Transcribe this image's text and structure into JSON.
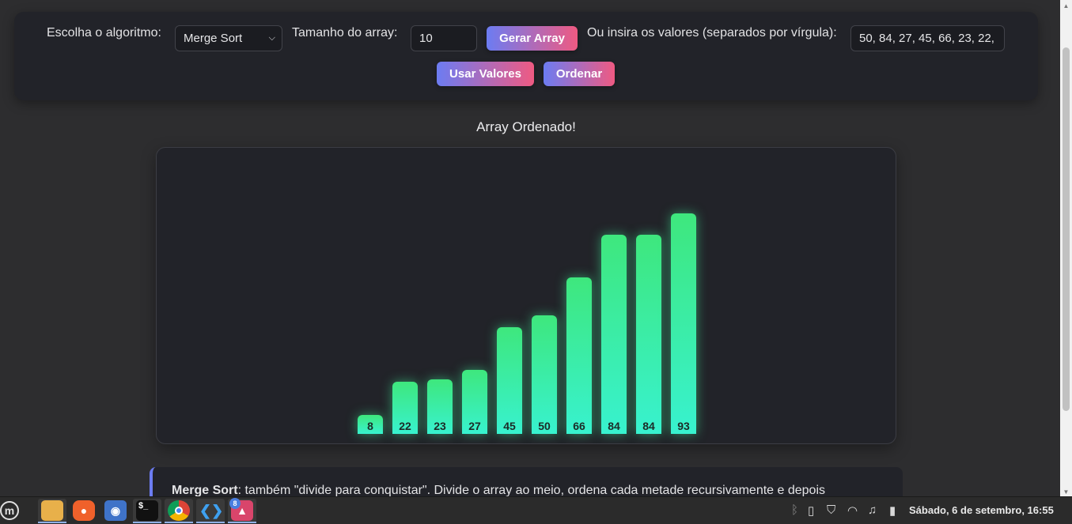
{
  "controls": {
    "algorithm_label": "Escolha o algoritmo:",
    "algorithm_selected": "Merge Sort",
    "size_label": "Tamanho do array:",
    "size_value": "10",
    "generate_button": "Gerar Array",
    "values_label": "Ou insira os valores (separados por vírgula):",
    "values_input": "50, 84, 27, 45, 66, 23, 22,",
    "use_values_button": "Usar Valores",
    "sort_button": "Ordenar"
  },
  "status_text": "Array Ordenado!",
  "chart_data": {
    "type": "bar",
    "values": [
      8,
      22,
      23,
      27,
      45,
      50,
      66,
      84,
      84,
      93
    ],
    "labels": [
      "8",
      "22",
      "23",
      "27",
      "45",
      "50",
      "66",
      "84",
      "84",
      "93"
    ],
    "bar_color_top": "#3ee77d",
    "bar_color_bottom": "#38f2cf"
  },
  "info": {
    "title": "Merge Sort",
    "text": ": também \"divide para conquistar\". Divide o array ao meio, ordena cada metade recursivamente e depois"
  },
  "taskbar": {
    "apps": [
      {
        "name": "menu-icon",
        "glyph": "m"
      },
      {
        "name": "files-icon",
        "glyph": ""
      },
      {
        "name": "firefox-icon",
        "glyph": "●"
      },
      {
        "name": "camera-icon",
        "glyph": "◉"
      },
      {
        "name": "terminal-icon",
        "glyph": "$_"
      },
      {
        "name": "chrome-icon",
        "glyph": "◎"
      },
      {
        "name": "vscode-icon",
        "glyph": "❮❯"
      },
      {
        "name": "image-viewer-icon",
        "glyph": "▲"
      }
    ],
    "badge": "8",
    "clock": "Sábado, 6 de setembro, 16:55"
  }
}
